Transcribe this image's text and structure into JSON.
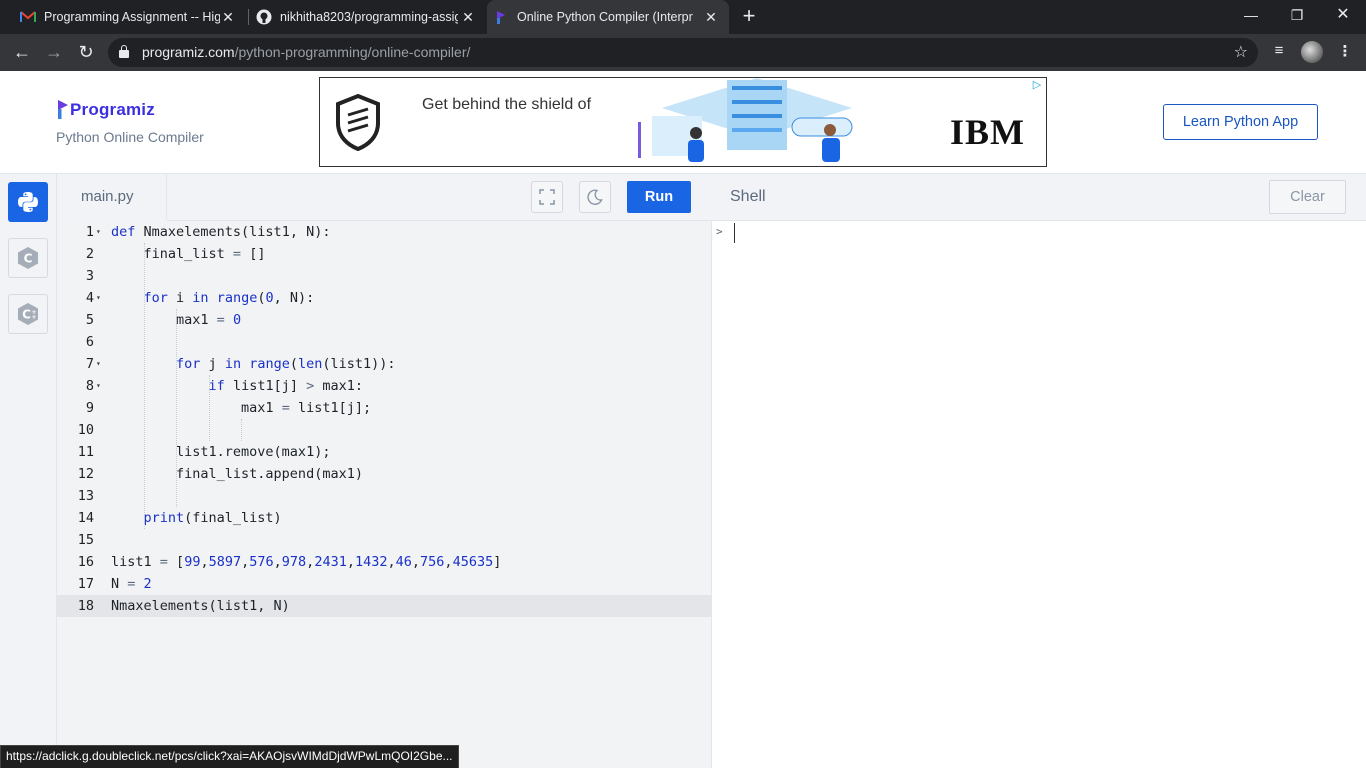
{
  "browser": {
    "tabs": [
      {
        "title": "Programming Assignment -- High",
        "favicon": "gmail-icon"
      },
      {
        "title": "nikhitha8203/programming-assig",
        "favicon": "github-icon"
      },
      {
        "title": "Online Python Compiler (Interpre",
        "favicon": "programiz-icon"
      }
    ],
    "url_host": "programiz.com",
    "url_path": "/python-programming/online-compiler/"
  },
  "header": {
    "logo": "Programiz",
    "subtitle": "Python Online Compiler",
    "learn_button": "Learn Python App",
    "ad_text": "Get behind the shield of",
    "ad_brand": "IBM"
  },
  "languages": [
    {
      "name": "python-icon",
      "active": true
    },
    {
      "name": "c-icon",
      "active": false
    },
    {
      "name": "cpp-icon",
      "active": false
    }
  ],
  "editor": {
    "filename": "main.py",
    "run_label": "Run",
    "active_line": 18,
    "lines": [
      "def Nmaxelements(list1, N):",
      "    final_list = []",
      "",
      "    for i in range(0, N):",
      "        max1 = 0",
      "",
      "        for j in range(len(list1)):",
      "            if list1[j] > max1:",
      "                max1 = list1[j];",
      "",
      "        list1.remove(max1);",
      "        final_list.append(max1)",
      "",
      "    print(final_list)",
      "",
      "list1 = [99,5897,576,978,2431,1432,46,756,45635]",
      "N = 2",
      "Nmaxelements(list1, N)"
    ]
  },
  "shell": {
    "title": "Shell",
    "clear_label": "Clear",
    "prompt": ">"
  },
  "status_url": "https://adclick.g.doubleclick.net/pcs/click?xai=AKAOjsvWIMdDjdWPwLmQOI2Gbe..."
}
